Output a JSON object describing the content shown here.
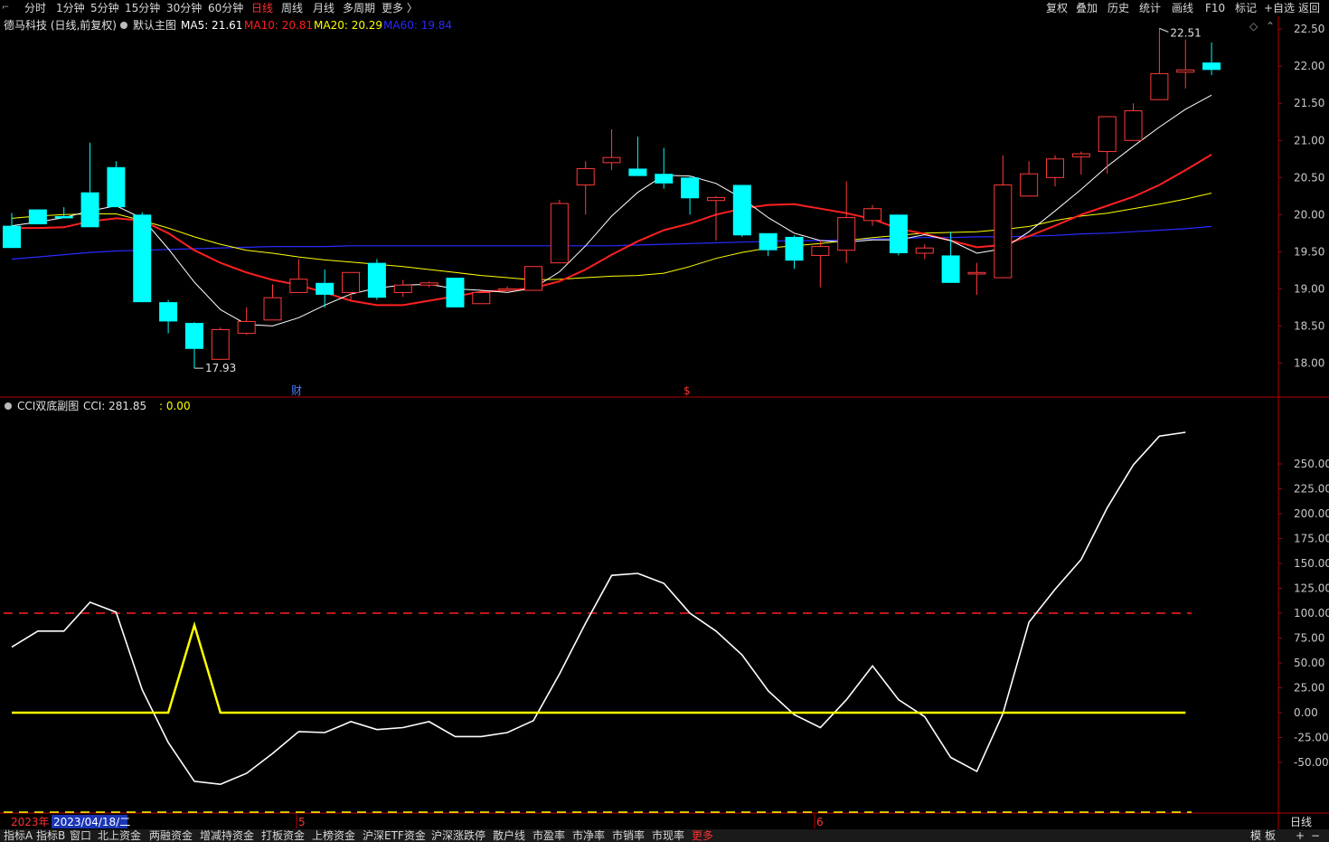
{
  "toolbar": {
    "periods": [
      {
        "label": "分时",
        "active": false
      },
      {
        "label": "1分钟",
        "active": false
      },
      {
        "label": "5分钟",
        "active": false
      },
      {
        "label": "15分钟",
        "active": false
      },
      {
        "label": "30分钟",
        "active": false
      },
      {
        "label": "60分钟",
        "active": false
      },
      {
        "label": "日线",
        "active": true
      },
      {
        "label": "周线",
        "active": false
      },
      {
        "label": "月线",
        "active": false
      },
      {
        "label": "多周期",
        "active": false
      },
      {
        "label": "更多 〉",
        "active": false
      }
    ],
    "right": [
      "复权",
      "叠加",
      "历史",
      "统计",
      "画线",
      "F10",
      "标记",
      "+自选",
      "返回"
    ]
  },
  "main_legend": {
    "stock": "德马科技 (日线,前复权)",
    "template": "默认主图",
    "ma": [
      {
        "label": "MA5: 21.61",
        "color": "#ffffff"
      },
      {
        "label": "MA10: 20.81",
        "color": "#ff2020"
      },
      {
        "label": "MA20: 20.29",
        "color": "#ffff00"
      },
      {
        "label": "MA60: 19.84",
        "color": "#2a2aff"
      }
    ]
  },
  "sub_legend": {
    "name": "CCI双底副图",
    "cci": "CCI: 281.85",
    "sig": ": 0.00"
  },
  "annotations": {
    "high": "22.51",
    "low": "17.93",
    "cai": "财",
    "dollar": "$"
  },
  "colors": {
    "up": "#ff3a3a",
    "down": "#00ffff",
    "ma5": "#ffffff",
    "ma10": "#ff2020",
    "ma20": "#ffff00",
    "ma60": "#2a2aff",
    "axis": "#b40000"
  },
  "time_axis": {
    "year": "2023年",
    "cursor": "2023/04/18/二",
    "months": [
      "5",
      "6"
    ],
    "period": "日线"
  },
  "bottom_tabs": [
    "指标A",
    "指标B",
    "窗口",
    "北上资金",
    "两融资金",
    "增减持资金",
    "打板资金",
    "上榜资金",
    "沪深ETF资金",
    "沪深涨跌停",
    "散户线",
    "市盈率",
    "市净率",
    "市销率",
    "市现率",
    "更多"
  ],
  "bottom_right": [
    "模",
    "板",
    "+",
    "−"
  ],
  "chart_data": [
    {
      "type": "candlestick",
      "ylim": [
        17.7,
        22.6
      ],
      "yticks": [
        "22.50",
        "22.00",
        "21.50",
        "21.00",
        "20.50",
        "20.00",
        "19.50",
        "19.00",
        "18.50",
        "18.00"
      ],
      "ohlc": [
        [
          19.85,
          20.02,
          19.65,
          19.55
        ],
        [
          20.07,
          20.02,
          20.07,
          19.87
        ],
        [
          19.98,
          20.1,
          19.95,
          19.95
        ],
        [
          20.3,
          20.97,
          20.3,
          19.83
        ],
        [
          20.64,
          20.72,
          20.1,
          20.1
        ],
        [
          20.0,
          20.03,
          19.4,
          18.82
        ],
        [
          18.82,
          18.85,
          18.4,
          18.56
        ],
        [
          18.54,
          18.55,
          17.93,
          18.19
        ],
        [
          18.05,
          18.48,
          18.05,
          18.45
        ],
        [
          18.4,
          18.75,
          18.38,
          18.56
        ],
        [
          18.58,
          19.06,
          18.58,
          18.88
        ],
        [
          18.95,
          19.4,
          18.95,
          19.13
        ],
        [
          19.08,
          19.26,
          18.75,
          18.92
        ],
        [
          18.95,
          19.22,
          18.85,
          19.22
        ],
        [
          19.35,
          19.4,
          18.85,
          18.88
        ],
        [
          18.95,
          19.12,
          18.89,
          19.05
        ],
        [
          19.05,
          19.1,
          19.02,
          19.08
        ],
        [
          19.15,
          19.15,
          18.79,
          18.75
        ],
        [
          18.8,
          18.95,
          18.8,
          18.95
        ],
        [
          18.98,
          19.03,
          18.98,
          19.0
        ],
        [
          18.98,
          19.3,
          18.98,
          19.3
        ],
        [
          19.35,
          20.2,
          19.35,
          20.15
        ],
        [
          20.4,
          20.72,
          20.0,
          20.62
        ],
        [
          20.7,
          21.15,
          20.6,
          20.77
        ],
        [
          20.62,
          21.05,
          20.52,
          20.52
        ],
        [
          20.55,
          20.9,
          20.35,
          20.42
        ],
        [
          20.5,
          20.52,
          20.0,
          20.22
        ],
        [
          20.19,
          20.25,
          19.65,
          20.23
        ],
        [
          20.4,
          20.4,
          19.7,
          19.72
        ],
        [
          19.75,
          19.75,
          19.44,
          19.52
        ],
        [
          19.7,
          19.72,
          19.27,
          19.38
        ],
        [
          19.45,
          19.65,
          19.02,
          19.57
        ],
        [
          19.52,
          20.45,
          19.35,
          19.96
        ],
        [
          19.92,
          20.13,
          19.85,
          20.08
        ],
        [
          20.0,
          20.0,
          19.45,
          19.48
        ],
        [
          19.48,
          19.6,
          19.4,
          19.55
        ],
        [
          19.45,
          19.77,
          19.08,
          19.08
        ],
        [
          19.2,
          19.35,
          18.92,
          19.22
        ],
        [
          19.15,
          20.8,
          19.15,
          20.4
        ],
        [
          20.25,
          20.72,
          20.25,
          20.55
        ],
        [
          20.5,
          20.8,
          20.38,
          20.75
        ],
        [
          20.78,
          20.85,
          20.54,
          20.82
        ],
        [
          20.85,
          21.2,
          20.55,
          21.32
        ],
        [
          21.0,
          21.5,
          21.0,
          21.4
        ],
        [
          21.55,
          22.51,
          21.55,
          21.9
        ],
        [
          21.92,
          22.36,
          21.7,
          21.95
        ],
        [
          22.05,
          22.32,
          21.88,
          21.95
        ]
      ],
      "ma5": [
        19.85,
        19.9,
        19.96,
        20.05,
        20.12,
        19.95,
        19.54,
        19.09,
        18.72,
        18.52,
        18.5,
        18.61,
        18.78,
        18.93,
        19.01,
        19.05,
        19.06,
        19.0,
        18.98,
        18.95,
        19.01,
        19.23,
        19.58,
        19.98,
        20.3,
        20.53,
        20.52,
        20.42,
        20.22,
        19.96,
        19.75,
        19.65,
        19.63,
        19.66,
        19.66,
        19.73,
        19.65,
        19.48,
        19.54,
        19.77,
        20.05,
        20.34,
        20.65,
        20.92,
        21.18,
        21.42,
        21.61
      ],
      "ma10": [
        19.82,
        19.82,
        19.83,
        19.91,
        19.95,
        19.92,
        19.75,
        19.52,
        19.35,
        19.22,
        19.12,
        19.05,
        18.95,
        18.84,
        18.78,
        18.78,
        18.84,
        18.9,
        18.96,
        18.98,
        19.01,
        19.1,
        19.26,
        19.46,
        19.64,
        19.79,
        19.88,
        20.0,
        20.08,
        20.13,
        20.14,
        20.08,
        20.02,
        19.94,
        19.81,
        19.74,
        19.65,
        19.56,
        19.59,
        19.71,
        19.85,
        20.0,
        20.12,
        20.24,
        20.4,
        20.6,
        20.81
      ],
      "ma20": [
        19.95,
        19.98,
        20.0,
        20.01,
        20.01,
        19.92,
        19.82,
        19.7,
        19.6,
        19.52,
        19.48,
        19.43,
        19.39,
        19.36,
        19.33,
        19.3,
        19.26,
        19.22,
        19.18,
        19.15,
        19.12,
        19.13,
        19.15,
        19.17,
        19.18,
        19.21,
        19.3,
        19.41,
        19.49,
        19.55,
        19.58,
        19.61,
        19.65,
        19.69,
        19.72,
        19.75,
        19.76,
        19.77,
        19.8,
        19.84,
        19.92,
        19.98,
        20.02,
        20.08,
        20.14,
        20.21,
        20.29
      ],
      "ma60": [
        19.4,
        19.43,
        19.46,
        19.49,
        19.51,
        19.52,
        19.53,
        19.54,
        19.55,
        19.56,
        19.57,
        19.57,
        19.57,
        19.58,
        19.58,
        19.58,
        19.58,
        19.58,
        19.58,
        19.58,
        19.58,
        19.58,
        19.58,
        19.58,
        19.59,
        19.6,
        19.61,
        19.62,
        19.63,
        19.64,
        19.65,
        19.65,
        19.66,
        19.67,
        19.68,
        19.69,
        19.69,
        19.7,
        19.7,
        19.71,
        19.72,
        19.74,
        19.75,
        19.77,
        19.79,
        19.81,
        19.84
      ]
    },
    {
      "type": "line",
      "ylim": [
        -100,
        300
      ],
      "yticks": [
        "250.00",
        "225.00",
        "200.00",
        "175.00",
        "150.00",
        "125.00",
        "100.00",
        "75.00",
        "50.00",
        "25.00",
        "0.00",
        "-25.00",
        "-50.00"
      ],
      "hlines": [
        {
          "value": 100,
          "color": "#ff2020"
        },
        {
          "value": -100,
          "color": "#ffff00"
        }
      ],
      "series": [
        {
          "color": "#ffffff",
          "values": [
            66,
            82,
            82,
            111,
            101,
            23,
            -30,
            -69,
            -72,
            -61,
            -41,
            -19,
            -20,
            -9,
            -17,
            -15,
            -9,
            -24,
            -24,
            -20,
            -8,
            39,
            90,
            138,
            140,
            130,
            100,
            82,
            58,
            22,
            -2,
            -15,
            13,
            47,
            13,
            -4,
            -45,
            -59,
            -1,
            91,
            124,
            154,
            206,
            249,
            278,
            281.85
          ]
        },
        {
          "color": "#ffff00",
          "values": [
            0,
            0,
            0,
            0,
            0,
            0,
            0,
            88,
            0,
            0,
            0,
            0,
            0,
            0,
            0,
            0,
            0,
            0,
            0,
            0,
            0,
            0,
            0,
            0,
            0,
            0,
            0,
            0,
            0,
            0,
            0,
            0,
            0,
            0,
            0,
            0,
            0,
            0,
            0,
            0,
            0,
            0,
            0,
            0,
            0,
            0
          ]
        }
      ]
    }
  ]
}
